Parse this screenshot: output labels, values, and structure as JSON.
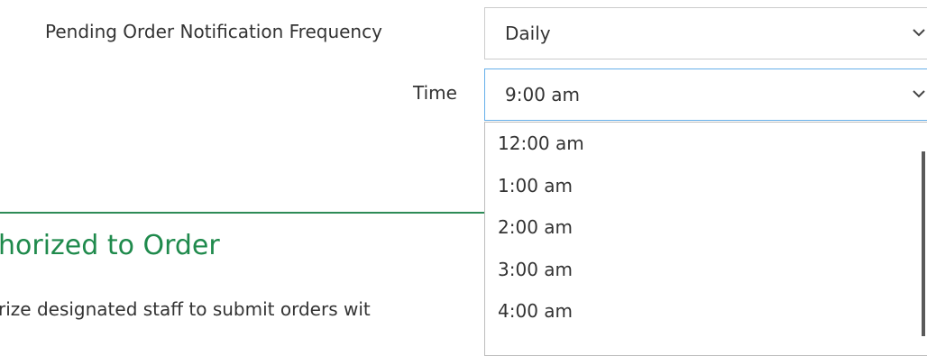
{
  "form": {
    "frequency": {
      "label": "Pending Order Notification Frequency",
      "value": "Daily"
    },
    "time": {
      "label": "Time",
      "value": "9:00 am"
    }
  },
  "section": {
    "title": "horized to Order",
    "description": "rize designated staff to submit orders wit"
  },
  "dropdown": {
    "options": [
      "12:00 am",
      "1:00 am",
      "2:00 am",
      "3:00 am",
      "4:00 am"
    ]
  },
  "colors": {
    "accent": "#1f8a4c",
    "focus_border": "#66afe9",
    "divider": "#2e8b57"
  },
  "icons": {
    "chevron": "chevron-down-icon"
  }
}
